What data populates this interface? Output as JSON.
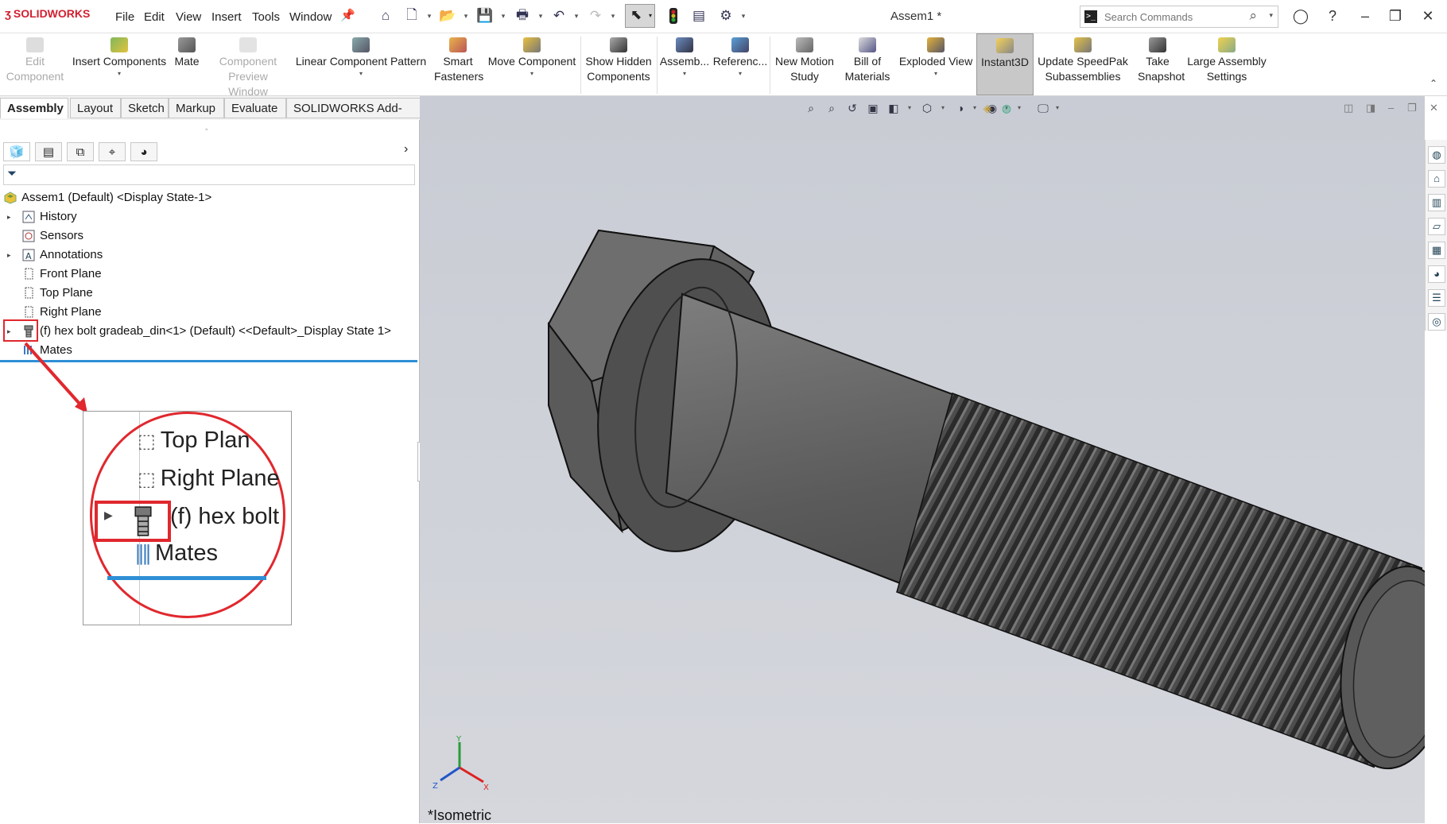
{
  "app": {
    "logo": "SOLIDWORKS",
    "doc_title": "Assem1 *"
  },
  "menu": [
    "File",
    "Edit",
    "View",
    "Insert",
    "Tools",
    "Window"
  ],
  "search": {
    "placeholder": "Search Commands"
  },
  "commands": [
    {
      "label": "Edit Component",
      "icon": "edit-component-icon",
      "disabled": true
    },
    {
      "label": "Insert Components",
      "icon": "insert-components-icon",
      "disabled": false
    },
    {
      "label": "Mate",
      "icon": "mate-icon",
      "disabled": false
    },
    {
      "label": "Component Preview Window",
      "icon": "preview-window-icon",
      "disabled": true
    },
    {
      "label": "Linear Component Pattern",
      "icon": "linear-pattern-icon",
      "disabled": false
    },
    {
      "label": "Smart Fasteners",
      "icon": "smart-fasteners-icon",
      "disabled": false
    },
    {
      "label": "Move Component",
      "icon": "move-component-icon",
      "disabled": false
    },
    {
      "label": "Show Hidden Components",
      "icon": "show-hidden-icon",
      "disabled": false
    },
    {
      "label": "Assemb...",
      "icon": "assembly-features-icon",
      "disabled": false
    },
    {
      "label": "Referenc...",
      "icon": "reference-geometry-icon",
      "disabled": false
    },
    {
      "label": "New Motion Study",
      "icon": "motion-study-icon",
      "disabled": false
    },
    {
      "label": "Bill of Materials",
      "icon": "bom-icon",
      "disabled": false
    },
    {
      "label": "Exploded View",
      "icon": "exploded-view-icon",
      "disabled": false
    },
    {
      "label": "Instant3D",
      "icon": "instant3d-icon",
      "disabled": false,
      "active": true
    },
    {
      "label": "Update SpeedPak Subassemblies",
      "icon": "speedpak-icon",
      "disabled": false
    },
    {
      "label": "Take Snapshot",
      "icon": "snapshot-icon",
      "disabled": false
    },
    {
      "label": "Large Assembly Settings",
      "icon": "large-assembly-icon",
      "disabled": false
    }
  ],
  "tabs": [
    "Assembly",
    "Layout",
    "Sketch",
    "Markup",
    "Evaluate",
    "SOLIDWORKS Add-Ins"
  ],
  "tree": {
    "root": "Assem1 (Default) <Display State-1>",
    "items": [
      "History",
      "Sensors",
      "Annotations",
      "Front Plane",
      "Top Plane",
      "Right Plane",
      "(f) hex bolt gradeab_din<1> (Default) <<Default>_Display State 1>",
      "Mates"
    ]
  },
  "zoom_callout": {
    "items": [
      "Top Plan",
      "Right Plane",
      "(f) hex bolt",
      "Mates"
    ]
  },
  "triad": {
    "x": "X",
    "y": "Y",
    "z": "Z"
  },
  "view_label": "*Isometric",
  "colors": {
    "highlight_red": "#e0282e",
    "accent_blue": "#2f8fd6"
  }
}
